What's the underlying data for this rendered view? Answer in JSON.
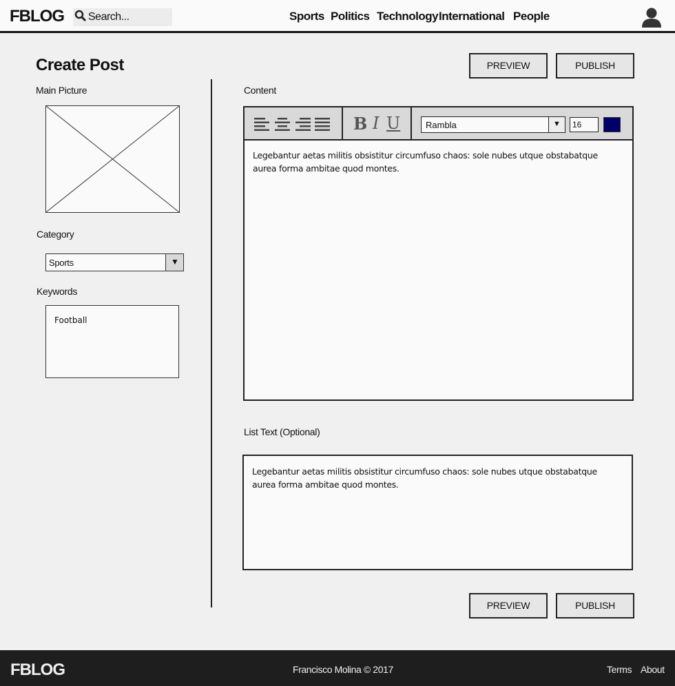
{
  "header": {
    "logo": "FBLOG",
    "search_placeholder": "Search...",
    "nav": [
      "Sports",
      "Politics",
      "Technology",
      "International",
      "People"
    ]
  },
  "page": {
    "title": "Create Post",
    "preview_label": "PREVIEW",
    "publish_label": "PUBLISH"
  },
  "left": {
    "main_picture_label": "Main Picture",
    "category_label": "Category",
    "category_value": "Sports",
    "keywords_label": "Keywords",
    "keywords_value": "Football"
  },
  "editor": {
    "content_label": "Content",
    "bold": "B",
    "italic": "I",
    "underline": "U",
    "font": "Rambla",
    "size": "16",
    "text_color": "#000066",
    "text": "Legebantur  aetas militis obsistitur circumfuso chaos: sole nubes utque obstabatque aurea forma ambitae quod montes."
  },
  "list_text": {
    "label": "List Text (Optional)",
    "text": "Legebantur  aetas militis obsistitur circumfuso chaos: sole nubes utque obstabatque aurea forma ambitae quod montes."
  },
  "footer": {
    "logo": "FBLOG",
    "copyright": "Francisco Molina © 2017",
    "terms": "Terms",
    "about": "About"
  }
}
